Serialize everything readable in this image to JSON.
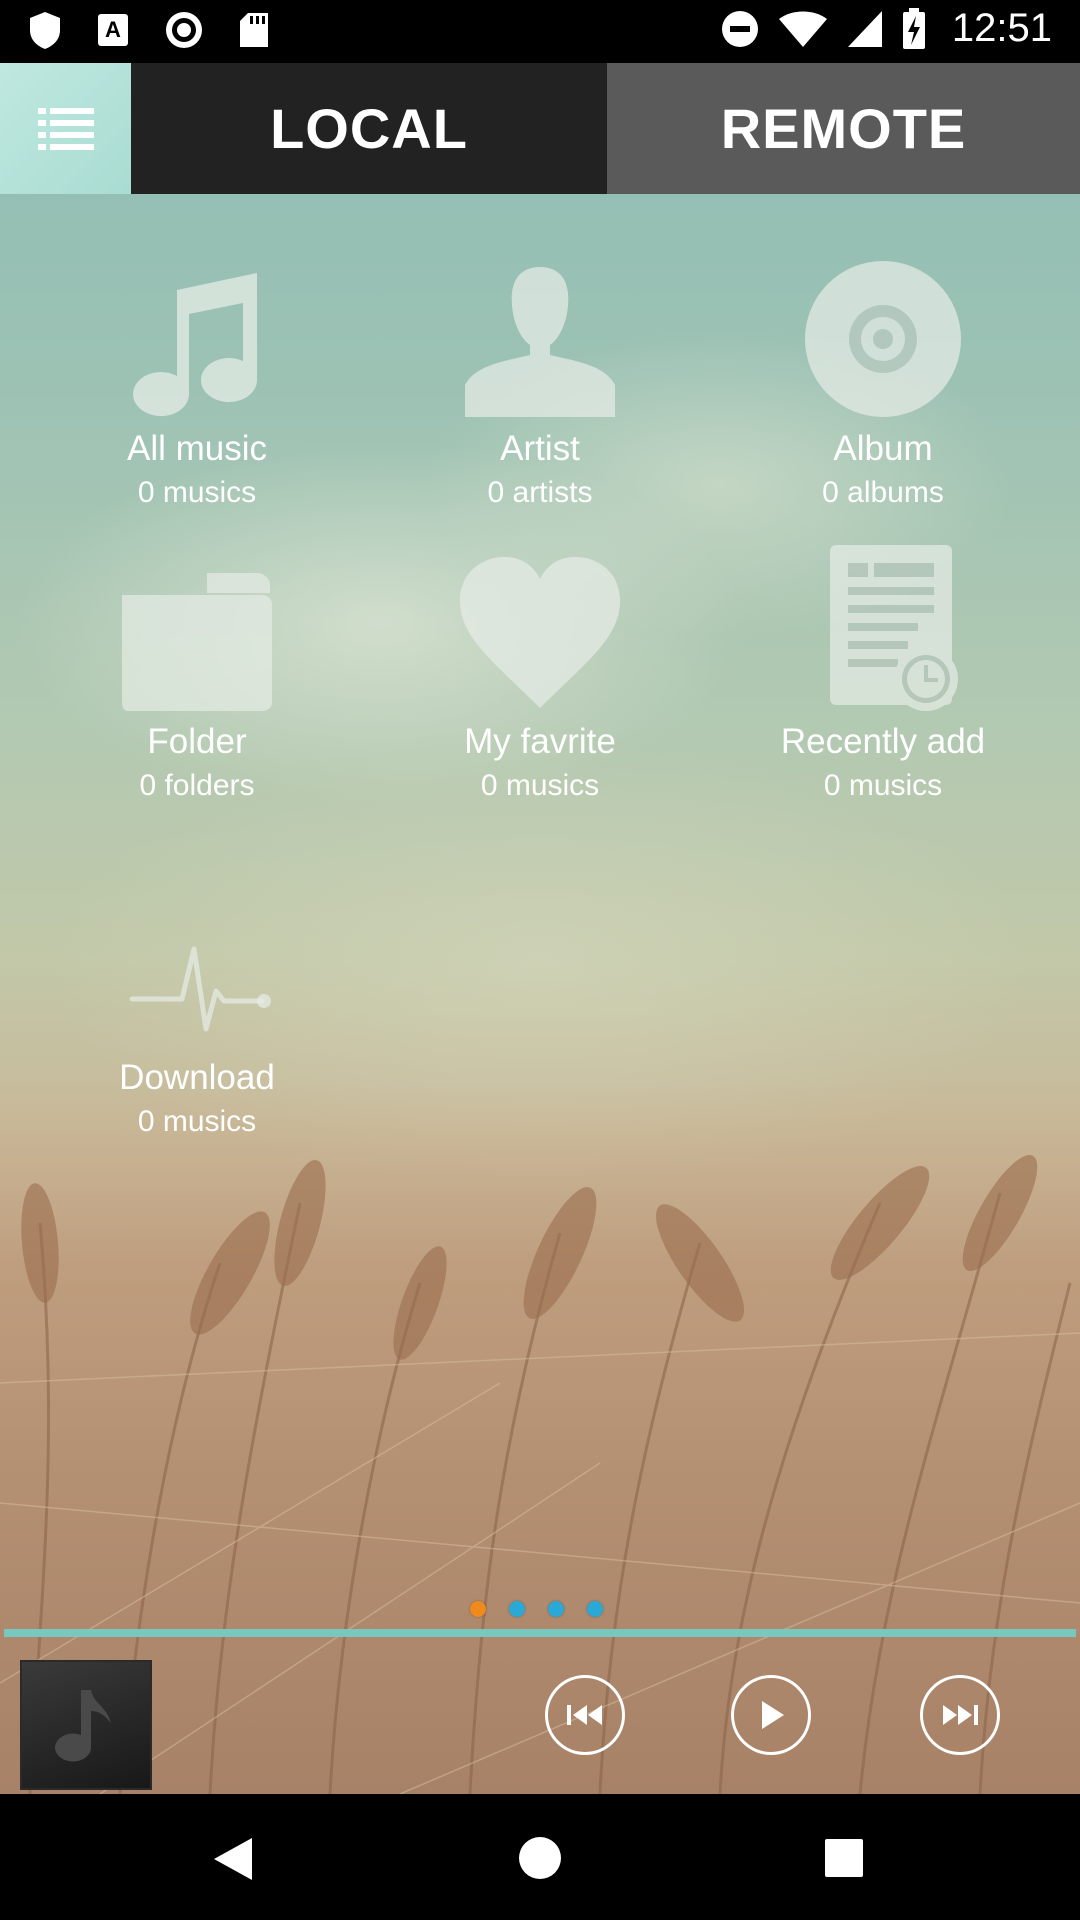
{
  "status_bar": {
    "time": "12:51",
    "left_icons": [
      "shield-icon",
      "keyboard-a-icon",
      "record-icon",
      "sd-card-icon"
    ],
    "right_icons": [
      "do-not-disturb-icon",
      "wifi-icon",
      "cell-signal-icon",
      "battery-charging-icon"
    ]
  },
  "tabs": {
    "local": "LOCAL",
    "remote": "REMOTE",
    "active": "LOCAL"
  },
  "categories": [
    {
      "title": "All music",
      "count": "0 musics",
      "icon": "music-note-icon"
    },
    {
      "title": "Artist",
      "count": "0 artists",
      "icon": "artist-icon"
    },
    {
      "title": "Album",
      "count": "0 albums",
      "icon": "album-disc-icon"
    },
    {
      "title": "Folder",
      "count": "0 folders",
      "icon": "folder-icon"
    },
    {
      "title": "My favrite",
      "count": "0 musics",
      "icon": "heart-icon"
    },
    {
      "title": "Recently add",
      "count": "0 musics",
      "icon": "recent-document-icon"
    },
    {
      "title": "Download",
      "count": "0 musics",
      "icon": "pulse-icon"
    }
  ],
  "pager": {
    "active_index": 0,
    "count": 4,
    "active_color": "#f08a1c",
    "inactive_color": "#2ba9d6"
  },
  "colors": {
    "progress": "#78c8c0",
    "tab_local_bg": "#222222",
    "tab_remote_bg": "#5a5a5a"
  },
  "player": {
    "controls": [
      "previous-icon",
      "play-icon",
      "next-icon"
    ]
  },
  "navigation": [
    "back-icon",
    "home-icon",
    "recents-icon"
  ]
}
